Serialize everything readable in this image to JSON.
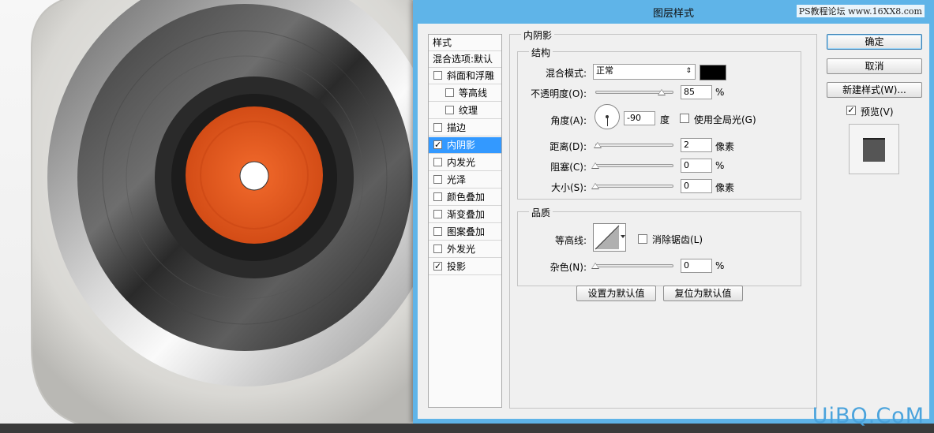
{
  "dialog": {
    "title": "图层样式",
    "watermark": "PS教程论坛 www.16XX8.com",
    "corner_watermark": "UiBQ.CoM"
  },
  "style_list": {
    "header": "样式",
    "blend_options": "混合选项:默认",
    "items": [
      {
        "label": "斜面和浮雕",
        "checked": false,
        "indent": false
      },
      {
        "label": "等高线",
        "checked": false,
        "indent": true
      },
      {
        "label": "纹理",
        "checked": false,
        "indent": true
      },
      {
        "label": "描边",
        "checked": false,
        "indent": false
      },
      {
        "label": "内阴影",
        "checked": true,
        "indent": false,
        "selected": true
      },
      {
        "label": "内发光",
        "checked": false,
        "indent": false
      },
      {
        "label": "光泽",
        "checked": false,
        "indent": false
      },
      {
        "label": "颜色叠加",
        "checked": false,
        "indent": false
      },
      {
        "label": "渐变叠加",
        "checked": false,
        "indent": false
      },
      {
        "label": "图案叠加",
        "checked": false,
        "indent": false
      },
      {
        "label": "外发光",
        "checked": false,
        "indent": false
      },
      {
        "label": "投影",
        "checked": true,
        "indent": false
      }
    ]
  },
  "inner_shadow": {
    "section_title": "内阴影",
    "structure": {
      "title": "结构",
      "blend_mode_label": "混合模式:",
      "blend_mode_value": "正常",
      "color": "#000000",
      "opacity_label": "不透明度(O):",
      "opacity_value": "85",
      "opacity_unit": "%",
      "angle_label": "角度(A):",
      "angle_value": "-90",
      "angle_unit": "度",
      "global_light_label": "使用全局光(G)",
      "global_light_checked": false,
      "distance_label": "距离(D):",
      "distance_value": "2",
      "distance_unit": "像素",
      "choke_label": "阻塞(C):",
      "choke_value": "0",
      "choke_unit": "%",
      "size_label": "大小(S):",
      "size_value": "0",
      "size_unit": "像素"
    },
    "quality": {
      "title": "品质",
      "contour_label": "等高线:",
      "anti_alias_label": "消除锯齿(L)",
      "anti_alias_checked": false,
      "noise_label": "杂色(N):",
      "noise_value": "0",
      "noise_unit": "%"
    },
    "make_default": "设置为默认值",
    "reset_default": "复位为默认值"
  },
  "buttons": {
    "ok": "确定",
    "cancel": "取消",
    "new_style": "新建样式(W)...",
    "preview_label": "预览(V)",
    "preview_checked": true
  },
  "colors": {
    "dialog_frame": "#5fb4e8",
    "selection": "#3399ff",
    "vinyl_label": "#e0541c"
  }
}
